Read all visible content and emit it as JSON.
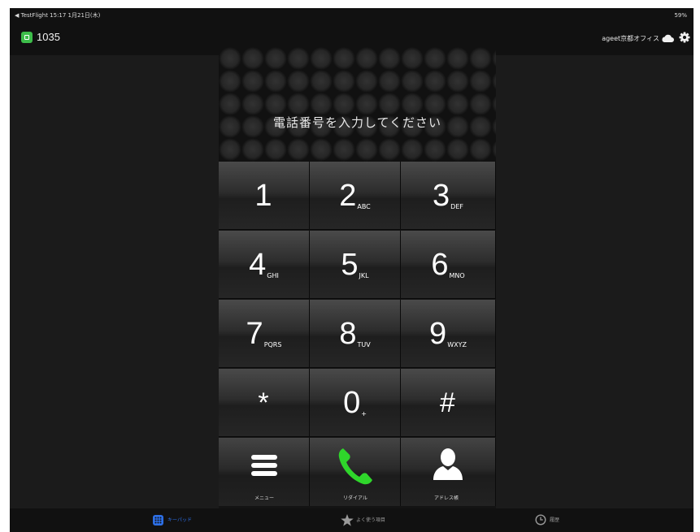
{
  "status_bar": {
    "left": "◀ TestFlight  15:17  1月21日(木)",
    "right": "59%"
  },
  "header": {
    "extension_number": "1035",
    "office_name": "ageet京都オフィス"
  },
  "dialer": {
    "prompt": "電話番号を入力してください",
    "keys": [
      {
        "digit": "1",
        "sub": ""
      },
      {
        "digit": "2",
        "sub": "ABC"
      },
      {
        "digit": "3",
        "sub": "DEF"
      },
      {
        "digit": "4",
        "sub": "GHI"
      },
      {
        "digit": "5",
        "sub": "JKL"
      },
      {
        "digit": "6",
        "sub": "MNO"
      },
      {
        "digit": "7",
        "sub": "PQRS"
      },
      {
        "digit": "8",
        "sub": "TUV"
      },
      {
        "digit": "9",
        "sub": "WXYZ"
      },
      {
        "digit": "*",
        "sub": ""
      },
      {
        "digit": "0",
        "sub": "+"
      },
      {
        "digit": "#",
        "sub": ""
      }
    ],
    "function_keys": {
      "menu": "メニュー",
      "redial": "リダイアル",
      "address_book": "アドレス帳"
    }
  },
  "tab_bar": {
    "keypad": "キーパッド",
    "favorites": "よく使う項目",
    "history": "履歴"
  },
  "colors": {
    "call_green": "#2fd62b",
    "tab_active": "#2d6fe6",
    "tab_inactive": "#9a9a9a",
    "app_icon": "#3dbd4a"
  },
  "icons": [
    "app-icon",
    "cloud-icon",
    "gear-icon",
    "menu-icon",
    "phone-icon",
    "contact-icon",
    "keypad-icon",
    "star-icon",
    "clock-icon"
  ]
}
